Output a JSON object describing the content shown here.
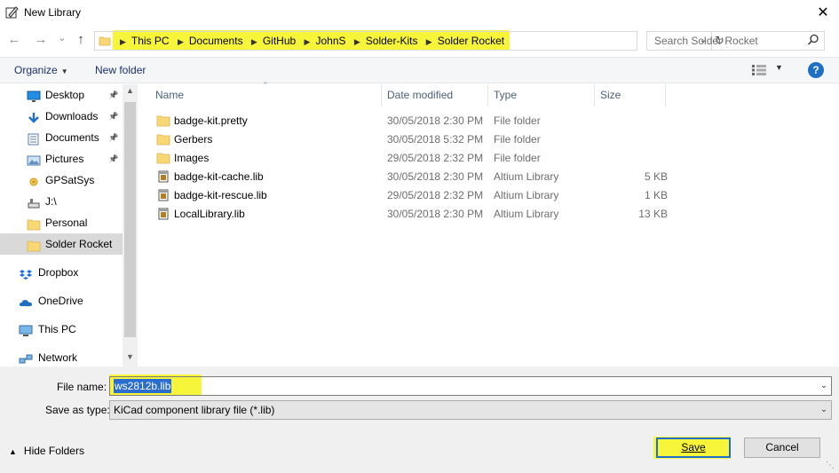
{
  "window": {
    "title": "New Library",
    "close_glyph": "✕"
  },
  "nav": {
    "back": "←",
    "forward": "→",
    "recent": "⌄",
    "up": "↑"
  },
  "address": {
    "crumbs": [
      "This PC",
      "Documents",
      "GitHub",
      "JohnS",
      "Solder-Kits",
      "Solder Rocket"
    ],
    "highlight_color": "#f7f53a"
  },
  "search": {
    "placeholder": "Search Solder Rocket"
  },
  "toolbar": {
    "organize": "Organize",
    "new_folder": "New folder",
    "help": "?"
  },
  "sidebar": {
    "items": [
      {
        "label": "Desktop",
        "icon": "desktop-icon",
        "pinned": true
      },
      {
        "label": "Downloads",
        "icon": "download-icon",
        "pinned": true
      },
      {
        "label": "Documents",
        "icon": "documents-icon",
        "pinned": true
      },
      {
        "label": "Pictures",
        "icon": "pictures-icon",
        "pinned": true
      },
      {
        "label": "GPSatSys",
        "icon": "gps-icon",
        "pinned": false
      },
      {
        "label": "J:\\",
        "icon": "drive-icon",
        "pinned": false
      },
      {
        "label": "Personal",
        "icon": "folder-icon",
        "pinned": false
      },
      {
        "label": "Solder Rocket",
        "icon": "folder-icon",
        "pinned": false,
        "selected": true
      },
      {
        "label": "Dropbox",
        "icon": "dropbox-icon",
        "top": true
      },
      {
        "label": "OneDrive",
        "icon": "onedrive-icon",
        "top": true
      },
      {
        "label": "This PC",
        "icon": "computer-icon",
        "top": true
      },
      {
        "label": "Network",
        "icon": "network-icon",
        "top": true
      }
    ]
  },
  "table": {
    "columns": [
      "Name",
      "Date modified",
      "Type",
      "Size"
    ],
    "rows": [
      {
        "name": "badge-kit.pretty",
        "date": "30/05/2018 2:30 PM",
        "type": "File folder",
        "size": "",
        "icon": "folder-icon"
      },
      {
        "name": "Gerbers",
        "date": "30/05/2018 5:32 PM",
        "type": "File folder",
        "size": "",
        "icon": "folder-icon"
      },
      {
        "name": "Images",
        "date": "29/05/2018 2:32 PM",
        "type": "File folder",
        "size": "",
        "icon": "folder-icon"
      },
      {
        "name": "badge-kit-cache.lib",
        "date": "30/05/2018 2:30 PM",
        "type": "Altium Library",
        "size": "5 KB",
        "icon": "library-file-icon"
      },
      {
        "name": "badge-kit-rescue.lib",
        "date": "29/05/2018 2:32 PM",
        "type": "Altium Library",
        "size": "1 KB",
        "icon": "library-file-icon"
      },
      {
        "name": "LocalLibrary.lib",
        "date": "30/05/2018 2:30 PM",
        "type": "Altium Library",
        "size": "13 KB",
        "icon": "library-file-icon"
      }
    ]
  },
  "form": {
    "file_name_label": "File name:",
    "file_name_value": "ws2812b.lib",
    "save_as_type_label": "Save as type:",
    "save_as_type_value": "KiCad component library file (*.lib)"
  },
  "footer": {
    "hide_folders": "Hide Folders",
    "save": "Save",
    "cancel": "Cancel"
  }
}
